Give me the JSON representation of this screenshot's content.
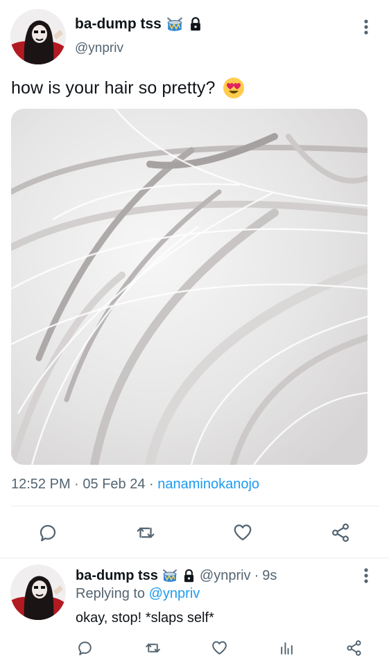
{
  "tweet": {
    "author": {
      "display_name": "ba-dump tss",
      "handle": "@ynpriv",
      "badge_emoji": "drum-icon",
      "protected_icon": "lock-icon",
      "avatar": "avatar-image"
    },
    "text": "how is your hair so pretty?",
    "text_emoji": "heart-eyes-emoji",
    "media": {
      "description_icon": "photo",
      "kind": "image"
    },
    "time": "12:52 PM",
    "separator": "·",
    "date": "05 Feb 24",
    "via": "nanaminokanojo",
    "actions": [
      {
        "icon": "reply-icon"
      },
      {
        "icon": "retweet-icon"
      },
      {
        "icon": "like-icon"
      },
      {
        "icon": "share-icon"
      }
    ]
  },
  "reply": {
    "author": {
      "display_name": "ba-dump tss",
      "handle": "@ynpriv",
      "badge_emoji": "drum-icon",
      "protected_icon": "lock-icon"
    },
    "dot": "·",
    "age": "9s",
    "replying_prefix": "Replying to",
    "replying_to": "@ynpriv",
    "text": "okay, stop! *slaps self*",
    "actions": [
      {
        "icon": "reply-icon"
      },
      {
        "icon": "retweet-icon"
      },
      {
        "icon": "like-icon"
      },
      {
        "icon": "analytics-icon"
      },
      {
        "icon": "share-icon"
      }
    ]
  },
  "colors": {
    "text": "#0f1419",
    "secondary": "#536471",
    "link": "#1d9bf0",
    "divider": "#e6ecf0"
  }
}
